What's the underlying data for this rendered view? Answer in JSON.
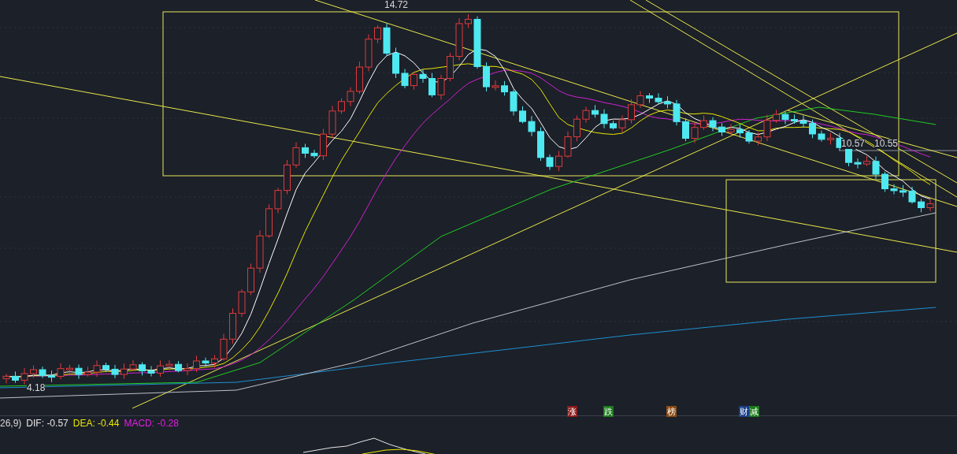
{
  "chart": {
    "price_labels": [
      {
        "kind": "high",
        "text": "14.72"
      },
      {
        "kind": "low",
        "text": "4.18"
      },
      {
        "kind": "cross",
        "text": "10.57"
      },
      {
        "kind": "cross-right",
        "text": "10.55"
      }
    ],
    "markers": [
      {
        "text": "涨",
        "color": "#8b1a1a"
      },
      {
        "text": "跌",
        "color": "#1a7a1a"
      },
      {
        "text": "榜",
        "color": "#8a4a10"
      },
      {
        "text": "财",
        "color": "#1a3f8a"
      },
      {
        "text": "减",
        "color": "#1a7a1a"
      }
    ]
  },
  "macd": {
    "params": "26,9)",
    "items": [
      {
        "label": "DIF:",
        "value": "-0.57",
        "color": "#e6e6e6"
      },
      {
        "label": "DEA:",
        "value": "-0.44",
        "color": "#e8e800"
      },
      {
        "label": "MACD:",
        "value": "-0.28",
        "color": "#e020e0"
      }
    ]
  }
}
